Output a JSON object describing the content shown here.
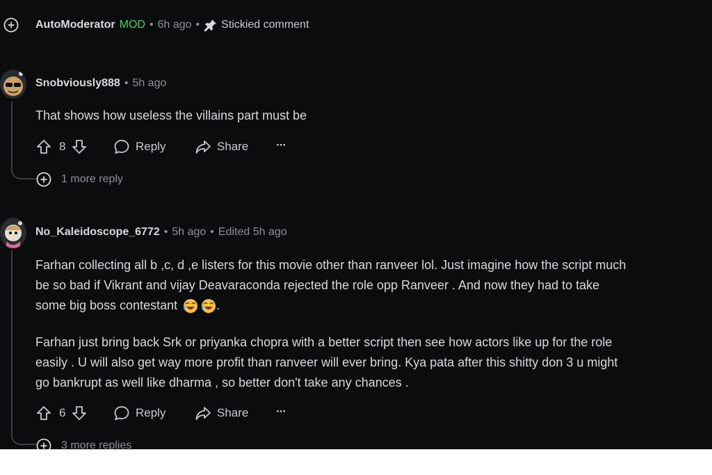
{
  "sticky": {
    "user": "AutoModerator",
    "badge": "MOD",
    "time": "6h ago",
    "stickied": "Stickied comment"
  },
  "comments": [
    {
      "user": "Snobviously888",
      "time": "5h ago",
      "text": "That shows how useless the villains part must be",
      "votes": "8",
      "reply": "Reply",
      "share": "Share",
      "more": "···",
      "more_replies": "1 more reply"
    },
    {
      "user": "No_Kaleidoscope_6772",
      "time": "5h ago",
      "edited": "Edited 5h ago",
      "paragraphs": [
        [
          "Farhan collecting all b ,c, d ,e listers for this movie other than ranveer lol. Just imagine how the script much",
          "be so bad if Vikrant and vijay Deavaraconda rejected the role opp Ranveer . And now they had to take",
          "some big boss contestant"
        ],
        [
          "Farhan just bring back Srk or priyanka chopra with a better script then see how actors like up for the role",
          "easily . U will also get way more profit than ranveer will ever bring. Kya pata after this shitty don 3 u might",
          "go bankrupt as well like dharma , so better don't take any chances ."
        ]
      ],
      "emoji_suffix": "😂😂.",
      "votes": "6",
      "reply": "Reply",
      "share": "Share",
      "more": "···",
      "more_replies": "3 more replies"
    }
  ]
}
